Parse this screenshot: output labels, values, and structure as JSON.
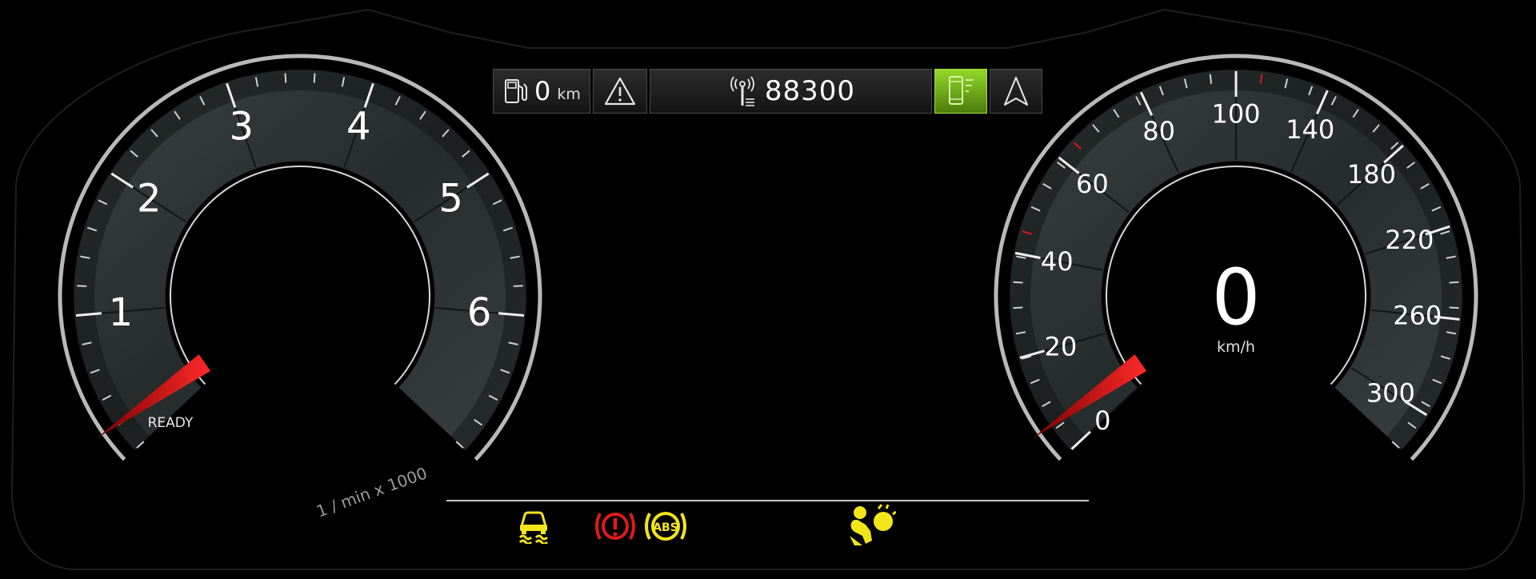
{
  "top_bar": {
    "fuel_range_value": "0",
    "fuel_range_unit": "km",
    "odometer": "88300"
  },
  "tachometer": {
    "labels": [
      "1",
      "2",
      "3",
      "4",
      "5",
      "6"
    ],
    "status": "READY",
    "unit": "1 / min x 1000",
    "needle_rpm": 0
  },
  "speedometer": {
    "labels": [
      "0",
      "20",
      "40",
      "60",
      "80",
      "100",
      "140",
      "180",
      "220",
      "260",
      "300"
    ],
    "speed": "0",
    "unit": "km/h"
  },
  "colors": {
    "background": "#000000",
    "needle": "#e0141a",
    "amber": "#f2e51a",
    "red_warning": "#e01a1a",
    "active_green": "#8fd42a"
  },
  "icons": [
    "fuel-pump-icon",
    "warning-triangle-icon",
    "radio-signal-icon",
    "smartphone-icon",
    "navigation-arrow-icon",
    "traction-control-icon",
    "brake-warning-icon",
    "abs-icon",
    "airbag-icon"
  ]
}
